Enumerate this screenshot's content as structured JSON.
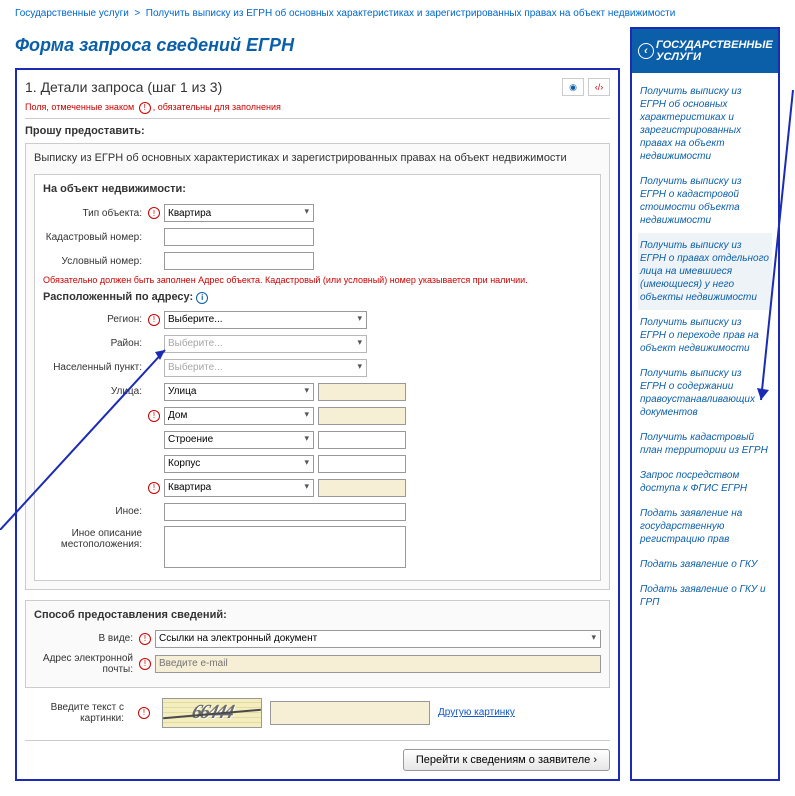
{
  "breadcrumb": {
    "root": "Государственные услуги",
    "sep": ">",
    "current": "Получить выписку из ЕГРН об основных характеристиках и зарегистрированных правах на объект недвижимости"
  },
  "page_title": "Форма запроса сведений ЕГРН",
  "step": {
    "title": "1. Детали запроса (шаг 1 из 3)",
    "required_hint_pre": "Поля, отмеченные знаком",
    "required_hint_post": "обязательны для заполнения",
    "icons": {
      "eye": "◉",
      "xml": "‹/›"
    }
  },
  "provide_label": "Прошу предоставить:",
  "doc_static": "Выписку из ЕГРН об основных характеристиках и зарегистрированных правах на объект недвижимости",
  "object_block": {
    "legend": "На объект недвижимости:",
    "type_label": "Тип объекта:",
    "type_value": "Квартира",
    "cadastral_label": "Кадастровый номер:",
    "conditional_label": "Условный номер:",
    "addr_note": "Обязательно должен быть заполнен Адрес объекта. Кадастровый (или условный) номер указывается при наличии.",
    "located_label": "Расположенный по адресу:",
    "region_label": "Регион:",
    "region_value": "Выберите...",
    "district_label": "Район:",
    "district_value": "Выберите...",
    "settlement_label": "Населенный пункт:",
    "settlement_value": "Выберите...",
    "street_label": "Улица:",
    "street_value": "Улица",
    "house_value": "Дом",
    "building_value": "Строение",
    "korpus_value": "Корпус",
    "flat_value": "Квартира",
    "other_label": "Иное:",
    "desc_label": "Иное описание местоположения:"
  },
  "delivery_block": {
    "legend": "Способ предоставления сведений:",
    "form_label": "В виде:",
    "form_value": "Ссылки на электронный документ",
    "email_label": "Адрес электронной почты:",
    "email_placeholder": "Введите e-mail"
  },
  "captcha": {
    "label": "Введите текст с картинки:",
    "image_text": "66444",
    "another": "Другую картинку"
  },
  "submit_label": "Перейти к сведениям о заявителе ›",
  "sidebar": {
    "header": "ГОСУДАРСТВЕННЫЕ УСЛУГИ",
    "items": [
      "Получить выписку из ЕГРН об основных характеристиках и зарегистрированных правах на объект недвижимости",
      "Получить выписку из ЕГРН о кадастровой стоимости объекта недвижимости",
      "Получить выписку из ЕГРН о правах отдельного лица на имевшиеся (имеющиеся) у него объекты недвижимости",
      "Получить выписку из ЕГРН о переходе прав на объект недвижимости",
      "Получить выписку из ЕГРН о содержании правоустанавливающих документов",
      "Получить кадастровый план территории из ЕГРН",
      "Запрос посредством доступа к ФГИС ЕГРН",
      "Подать заявление на государственную регистрацию прав",
      "Подать заявление о ГКУ",
      "Подать заявление о ГКУ и ГРП"
    ]
  }
}
